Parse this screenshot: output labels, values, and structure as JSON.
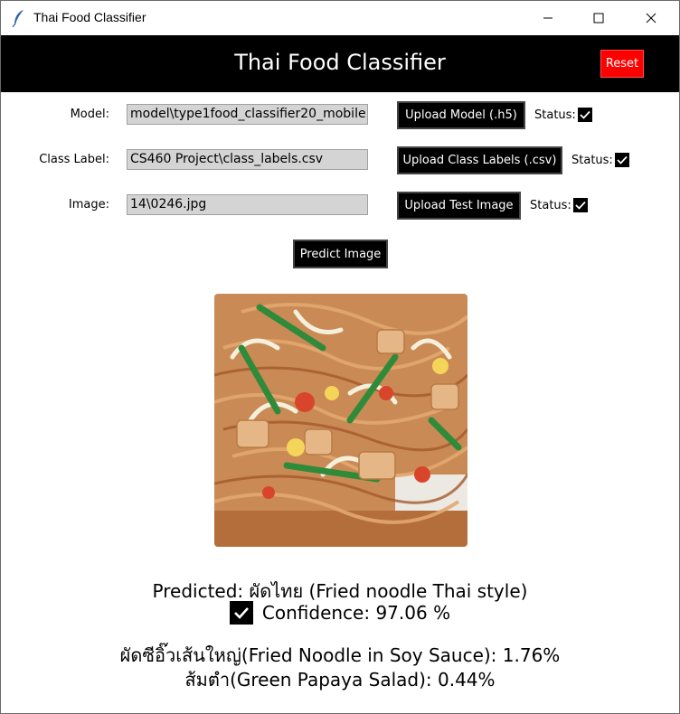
{
  "window": {
    "title": "Thai Food Classifier",
    "icon": "feather-icon"
  },
  "header": {
    "title": "Thai Food Classifier",
    "reset_label": "Reset"
  },
  "form": {
    "model": {
      "label": "Model:",
      "value": "model\\type1food_classifier20_mobile",
      "button": "Upload Model (.h5)",
      "status": "Status:"
    },
    "class_label": {
      "label": "Class Label:",
      "value": "CS460 Project\\class_labels.csv",
      "button": "Upload Class Labels (.csv)",
      "status": "Status:"
    },
    "image": {
      "label": "Image:",
      "value": "14\\0246.jpg",
      "button": "Upload Test Image",
      "status": "Status:"
    },
    "predict_label": "Predict Image"
  },
  "result": {
    "predicted": "Predicted: ผัดไทย (Fried noodle Thai style)",
    "confidence": "Confidence: 97.06 %",
    "alt1": "ผัดซีอิ๊วเส้นใหญ่(Fried Noodle in Soy Sauce): 1.76%",
    "alt2": "ส้มตำ(Green Papaya Salad): 0.44%"
  },
  "colors": {
    "header_bg": "#000000",
    "reset_bg": "#ff0000",
    "entry_bg": "#d4d4d4"
  }
}
